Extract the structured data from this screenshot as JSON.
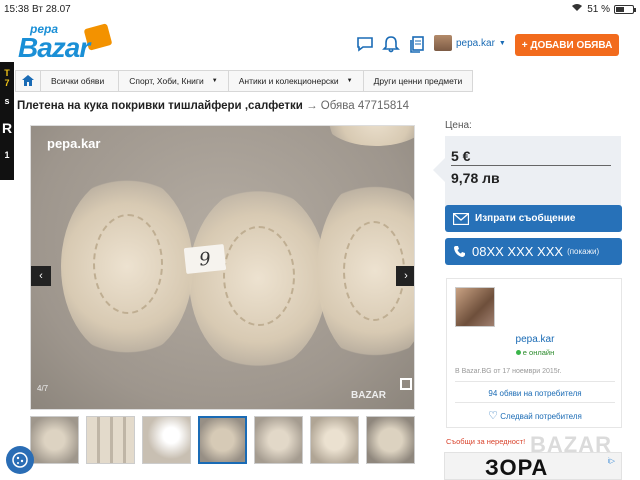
{
  "status_bar": {
    "time": "15:38",
    "date": "Вт 28.07",
    "battery": "51 %",
    "battery_level": 0.51
  },
  "header": {
    "logo_small": "pepa",
    "logo_big": "Bazar",
    "username": "pepa.kar",
    "add_button": "+ ДОБАВИ ОБЯВА",
    "icons": [
      "chat-icon",
      "bell-icon",
      "documents-icon"
    ]
  },
  "left_ad": {
    "lines": [
      "T",
      "7",
      "s",
      "R",
      "1"
    ]
  },
  "breadcrumb": {
    "items": [
      "Всички обяви",
      "Спорт, Хоби, Книги",
      "Антики и колекционерски",
      "Други ценни предмети"
    ]
  },
  "listing": {
    "title": "Плетена на кука покривки тишлайфери ,салфетки",
    "arrow": "→",
    "id_label": "Обява 47715814"
  },
  "gallery": {
    "watermark": "pepa.kar",
    "watermark_bottom": "BAZAR",
    "tag_text": "9",
    "counter": "4/7",
    "prev": "‹",
    "next": "›",
    "thumb_count": 7,
    "active_thumb": 3
  },
  "price": {
    "label": "Цена:",
    "eur": "5 €",
    "bgn": "9,78 лв"
  },
  "actions": {
    "message": "Изпрати съобщение",
    "phone": "08XX XXX XXX",
    "phone_show": "(покажи)"
  },
  "seller": {
    "name": "pepa.kar",
    "status": "е онлайн",
    "since": "В Bazar.BG от 17 ноември 2015г.",
    "listings": "94 обяви на потребителя",
    "follow": "Следвай потребителя"
  },
  "report": "Съобщи за нередност!",
  "bottom_ad": {
    "brand": "ЗОРА",
    "ad_marker": "i▷",
    "overlay": "BAZAR"
  },
  "colors": {
    "brand_blue": "#1a8fd6",
    "action_blue": "#2771b8",
    "orange": "#f26b1d"
  }
}
